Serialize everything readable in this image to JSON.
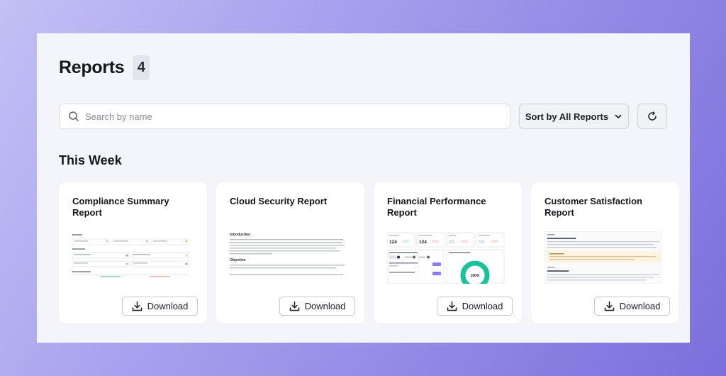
{
  "header": {
    "title": "Reports",
    "count": "4"
  },
  "search": {
    "placeholder": "Search by name",
    "value": ""
  },
  "sort": {
    "label": "Sort by All Reports"
  },
  "section": {
    "title": "This Week"
  },
  "cards": [
    {
      "title": "Compliance Summary Report",
      "download_label": "Download"
    },
    {
      "title": "Cloud Security Report",
      "download_label": "Download"
    },
    {
      "title": "Financial Performance Report",
      "download_label": "Download"
    },
    {
      "title": "Customer Satisfaction Report",
      "download_label": "Download"
    }
  ],
  "thumbs": {
    "cloud_intro": "Introduction",
    "cloud_objective": "Objective",
    "fin_kpi_1": "124",
    "fin_kpi_2": "124",
    "fin_donut": "100%"
  },
  "colors": {
    "accent": "#6c5ce7",
    "teal": "#18c29c"
  }
}
